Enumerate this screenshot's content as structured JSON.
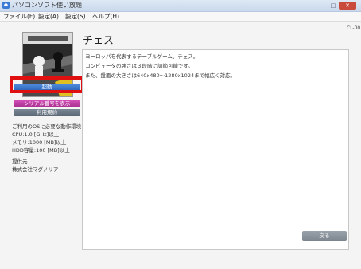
{
  "window": {
    "title": "パソコンソフト使い放題",
    "controls": {
      "minimize": "—",
      "maximize": "□",
      "close": "✕"
    }
  },
  "menu": {
    "items": [
      {
        "label": "ファイル(F)"
      },
      {
        "label": "設定(A)"
      },
      {
        "label": "設定(S)"
      },
      {
        "label": "ヘルプ(H)"
      }
    ]
  },
  "sidebar": {
    "launch_button": "起動",
    "serial_button": "シリアル番号を表示",
    "terms_button": "利用規約",
    "requirements": {
      "heading": "ご利用のOSに必要な動作環境",
      "cpu": "CPU:1.0 [GHz]以上",
      "memory": "メモリ:1000 [MB]以上",
      "hdd": "HDD容量:100 [MB]以上"
    },
    "provider": {
      "label": "提供元",
      "name": "株式会社マグノリア"
    }
  },
  "main": {
    "title": "チェス",
    "code": "CL-00",
    "description": [
      "ヨーロッパを代表するテーブルゲーム、チェス。",
      "コンピュータの強さは３段階に調節可能です。",
      "また、盤面の大きさは640x480～1280x1024まで幅広く対応。"
    ],
    "back_button": "戻る"
  },
  "colors": {
    "launch": "#2d63b8",
    "serial": "#a62e8d",
    "terms": "#5b6775",
    "highlight": "#e01010"
  }
}
